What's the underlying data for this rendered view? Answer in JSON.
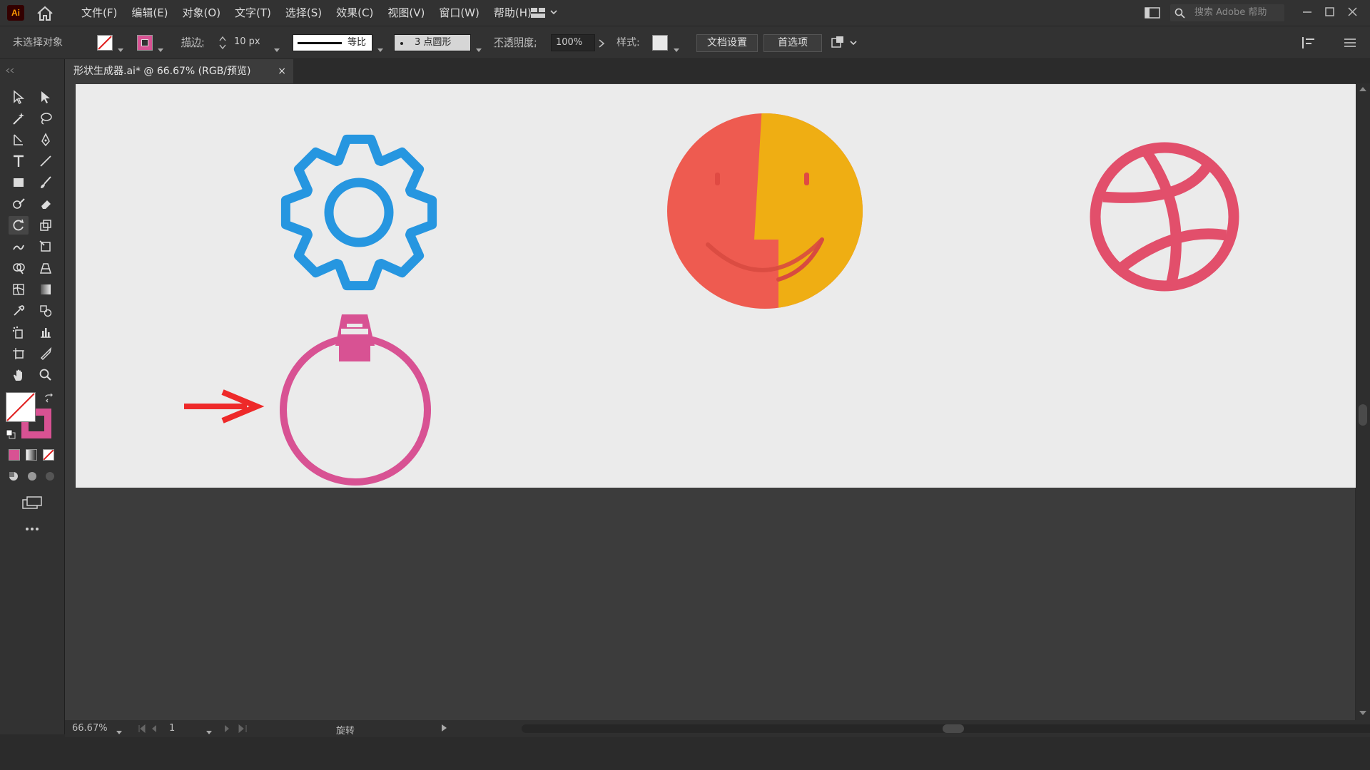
{
  "app": {
    "logo_text": "Ai"
  },
  "menu": [
    "文件(F)",
    "编辑(E)",
    "对象(O)",
    "文字(T)",
    "选择(S)",
    "效果(C)",
    "视图(V)",
    "窗口(W)",
    "帮助(H)"
  ],
  "search": {
    "placeholder": "搜索 Adobe 帮助"
  },
  "control": {
    "selection_status": "未选择对象",
    "stroke_label": "描边:",
    "stroke_value": "10 px",
    "profile_label": "等比",
    "brush_label": "3 点圆形",
    "opacity_label": "不透明度:",
    "opacity_value": "100%",
    "style_label": "样式:",
    "doc_setup": "文档设置",
    "preferences": "首选项"
  },
  "document": {
    "tab_title": "形状生成器.ai* @ 66.67% (RGB/预览)",
    "close": "×"
  },
  "status": {
    "zoom": "66.67%",
    "artboard": "1",
    "tool": "旋转"
  },
  "colors": {
    "gear": "#2696e0",
    "smiley_left": "#ee5b50",
    "smiley_right": "#efae13",
    "ball": "#e24f6b",
    "ornament": "#d85293",
    "arrow": "#ee2929"
  },
  "icons": [
    "home-icon",
    "selection-tool-icon",
    "direct-selection-icon",
    "magic-wand-icon",
    "lasso-icon",
    "pen-icon",
    "curvature-icon",
    "type-icon",
    "line-icon",
    "rectangle-icon",
    "paintbrush-icon",
    "shaper-icon",
    "eraser-icon",
    "rotate-icon",
    "scale-icon",
    "warp-icon",
    "free-transform-icon",
    "shape-builder-icon",
    "perspective-icon",
    "mesh-icon",
    "gradient-icon",
    "eyedropper-icon",
    "blend-icon",
    "symbol-sprayer-icon",
    "graph-icon",
    "artboard-icon",
    "slice-icon",
    "hand-icon",
    "zoom-icon"
  ]
}
